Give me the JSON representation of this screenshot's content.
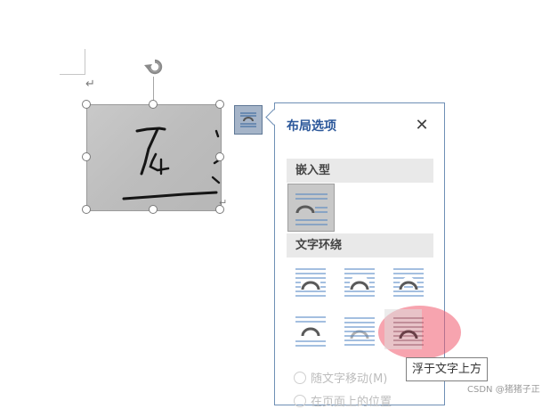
{
  "document": {
    "paragraph_mark": "↵",
    "anchor_mark": "↵"
  },
  "layout_panel": {
    "title": "布局选项",
    "close_label": "✕",
    "section_inline": "嵌入型",
    "section_wrap": "文字环绕",
    "options_wrap": [
      "square",
      "tight",
      "through",
      "top-and-bottom",
      "behind-text",
      "in-front-of-text"
    ],
    "selected_option": "inline",
    "hovered_option": "in-front-of-text",
    "radio_move_with_text": "随文字移动(M)",
    "radio_fix_position": "在页面上的位置"
  },
  "tooltip": {
    "text": "浮于文字上方"
  },
  "watermark": "CSDN @猪猪子正",
  "colors": {
    "accent": "#2b579a",
    "line_blue": "#4a7fc1",
    "hover_red": "#f05a6e"
  }
}
